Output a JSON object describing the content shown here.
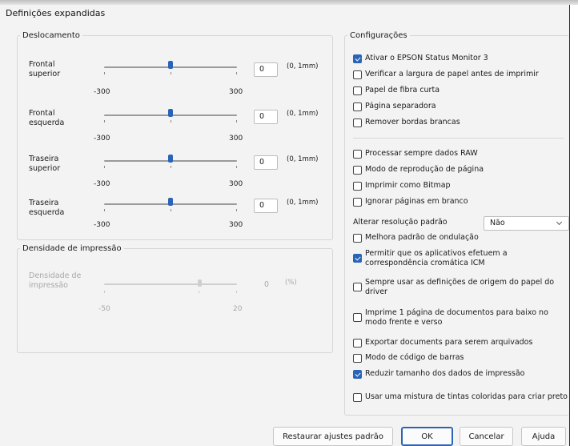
{
  "window": {
    "title": "Definições expandidas"
  },
  "deslocamento": {
    "legend": "Deslocamento",
    "min_label": "-300",
    "max_label": "300",
    "unit": "(0, 1mm)",
    "rows": [
      {
        "line1": "Frontal",
        "line2": "superior",
        "value": "0"
      },
      {
        "line1": "Frontal",
        "line2": "esquerda",
        "value": "0"
      },
      {
        "line1": "Traseira",
        "line2": "superior",
        "value": "0"
      },
      {
        "line1": "Traseira",
        "line2": "esquerda",
        "value": "0"
      }
    ]
  },
  "densidade": {
    "legend": "Densidade de impressão",
    "line1": "Densidade de",
    "line2": "impressão",
    "value": "0",
    "unit": "(%)",
    "min_label": "-50",
    "max_label": "20"
  },
  "configuracoes": {
    "legend": "Configurações",
    "group1": [
      {
        "label": "Ativar o EPSON Status Monitor 3",
        "checked": true
      },
      {
        "label": "Verificar a largura de papel antes de imprimir",
        "checked": false
      },
      {
        "label": "Papel de fibra curta",
        "checked": false
      },
      {
        "label": "Página separadora",
        "checked": false
      },
      {
        "label": "Remover bordas brancas",
        "checked": false
      }
    ],
    "group2": [
      {
        "label": "Processar sempre dados RAW",
        "checked": false
      },
      {
        "label": "Modo de reprodução de página",
        "checked": false
      },
      {
        "label": "Imprimir como Bitmap",
        "checked": false
      },
      {
        "label": "Ignorar páginas em branco",
        "checked": false
      }
    ],
    "resolution_label": "Alterar resolução padrão",
    "resolution_value": "Não",
    "group3": [
      {
        "line1": "Melhora padrão de ondulação",
        "line2": "",
        "checked": false
      },
      {
        "line1": "Permitir que os aplicativos efetuem a",
        "line2": "correspondência cromática ICM",
        "checked": true
      },
      {
        "line1": "Sempre usar as definições de origem do papel do",
        "line2": "driver",
        "checked": false
      },
      {
        "line1": "Imprime 1 página de documentos para baixo no",
        "line2": "modo frente e verso",
        "checked": false
      },
      {
        "line1": "Exportar documents para serem arquivados",
        "line2": "",
        "checked": false
      },
      {
        "line1": "Modo de código de barras",
        "line2": "",
        "checked": false
      },
      {
        "line1": "Reduzir tamanho dos dados de impressão",
        "line2": "",
        "checked": true
      },
      {
        "line1": "Usar uma mistura de tintas coloridas para criar preto",
        "line2": "",
        "checked": false
      }
    ]
  },
  "buttons": {
    "restore": "Restaurar ajustes padrão",
    "ok": "OK",
    "cancel": "Cancelar",
    "help": "Ajuda"
  }
}
